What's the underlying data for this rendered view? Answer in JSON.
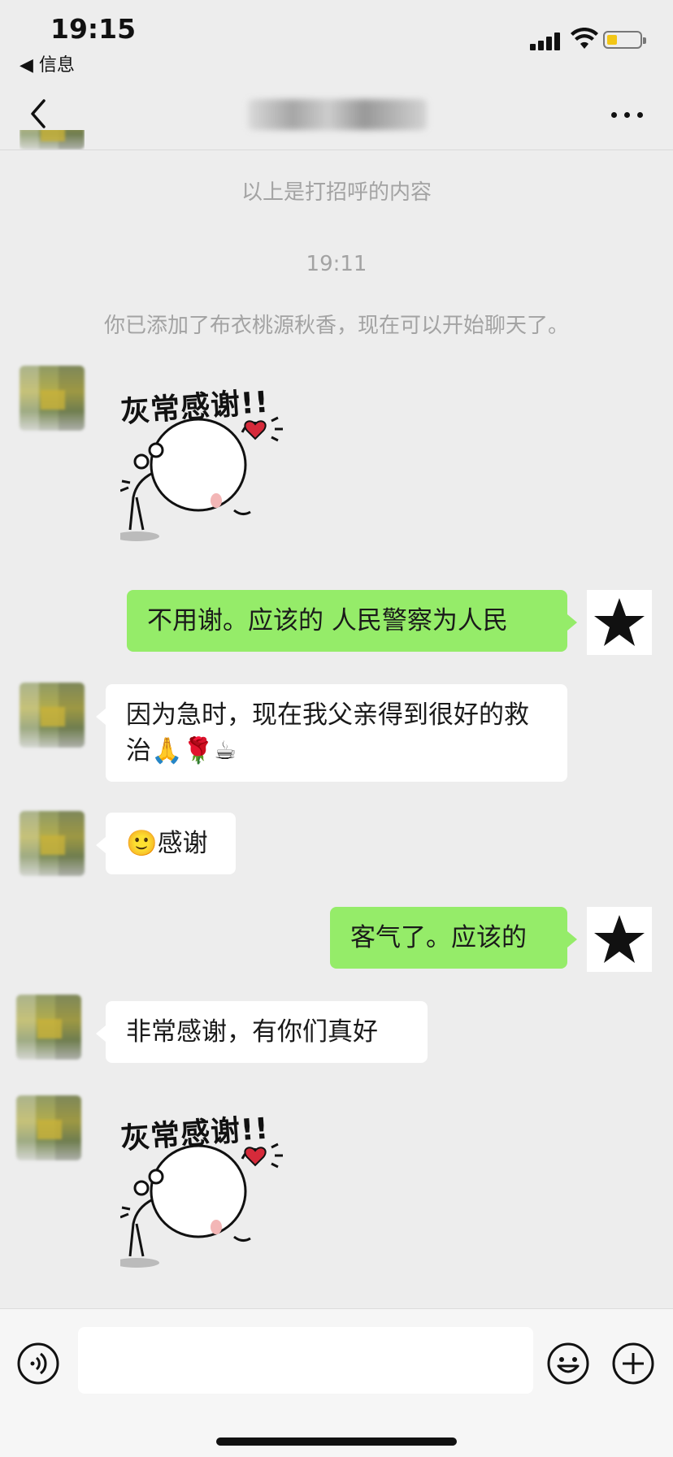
{
  "status_bar": {
    "time": "19:15",
    "back_app_label": "◀ 信息"
  },
  "header": {
    "title": "布衣桃源秋香",
    "back_icon": "chevron-left-icon",
    "more_icon": "more-dots-icon"
  },
  "system_messages": {
    "greeting_note": "以上是打招呼的内容",
    "timestamp": "19:11",
    "added_note": "你已添加了布衣桃源秋香，现在可以开始聊天了。"
  },
  "sticker": {
    "caption": "灰常感谢!!"
  },
  "messages": [
    {
      "from": "self",
      "text": "不用谢。应该的 人民警察为人民"
    },
    {
      "from": "contact",
      "text": "因为急时，现在我父亲得到很好的救治🙏🌹☕"
    },
    {
      "from": "contact",
      "text": "🙂感谢"
    },
    {
      "from": "self",
      "text": "客气了。应该的"
    },
    {
      "from": "contact",
      "text": "非常感谢，有你们真好"
    }
  ],
  "input_bar": {
    "placeholder": ""
  },
  "colors": {
    "background": "#ededed",
    "outgoing_bubble": "#95ec69",
    "incoming_bubble": "#ffffff",
    "system_text": "#a3a3a3"
  }
}
